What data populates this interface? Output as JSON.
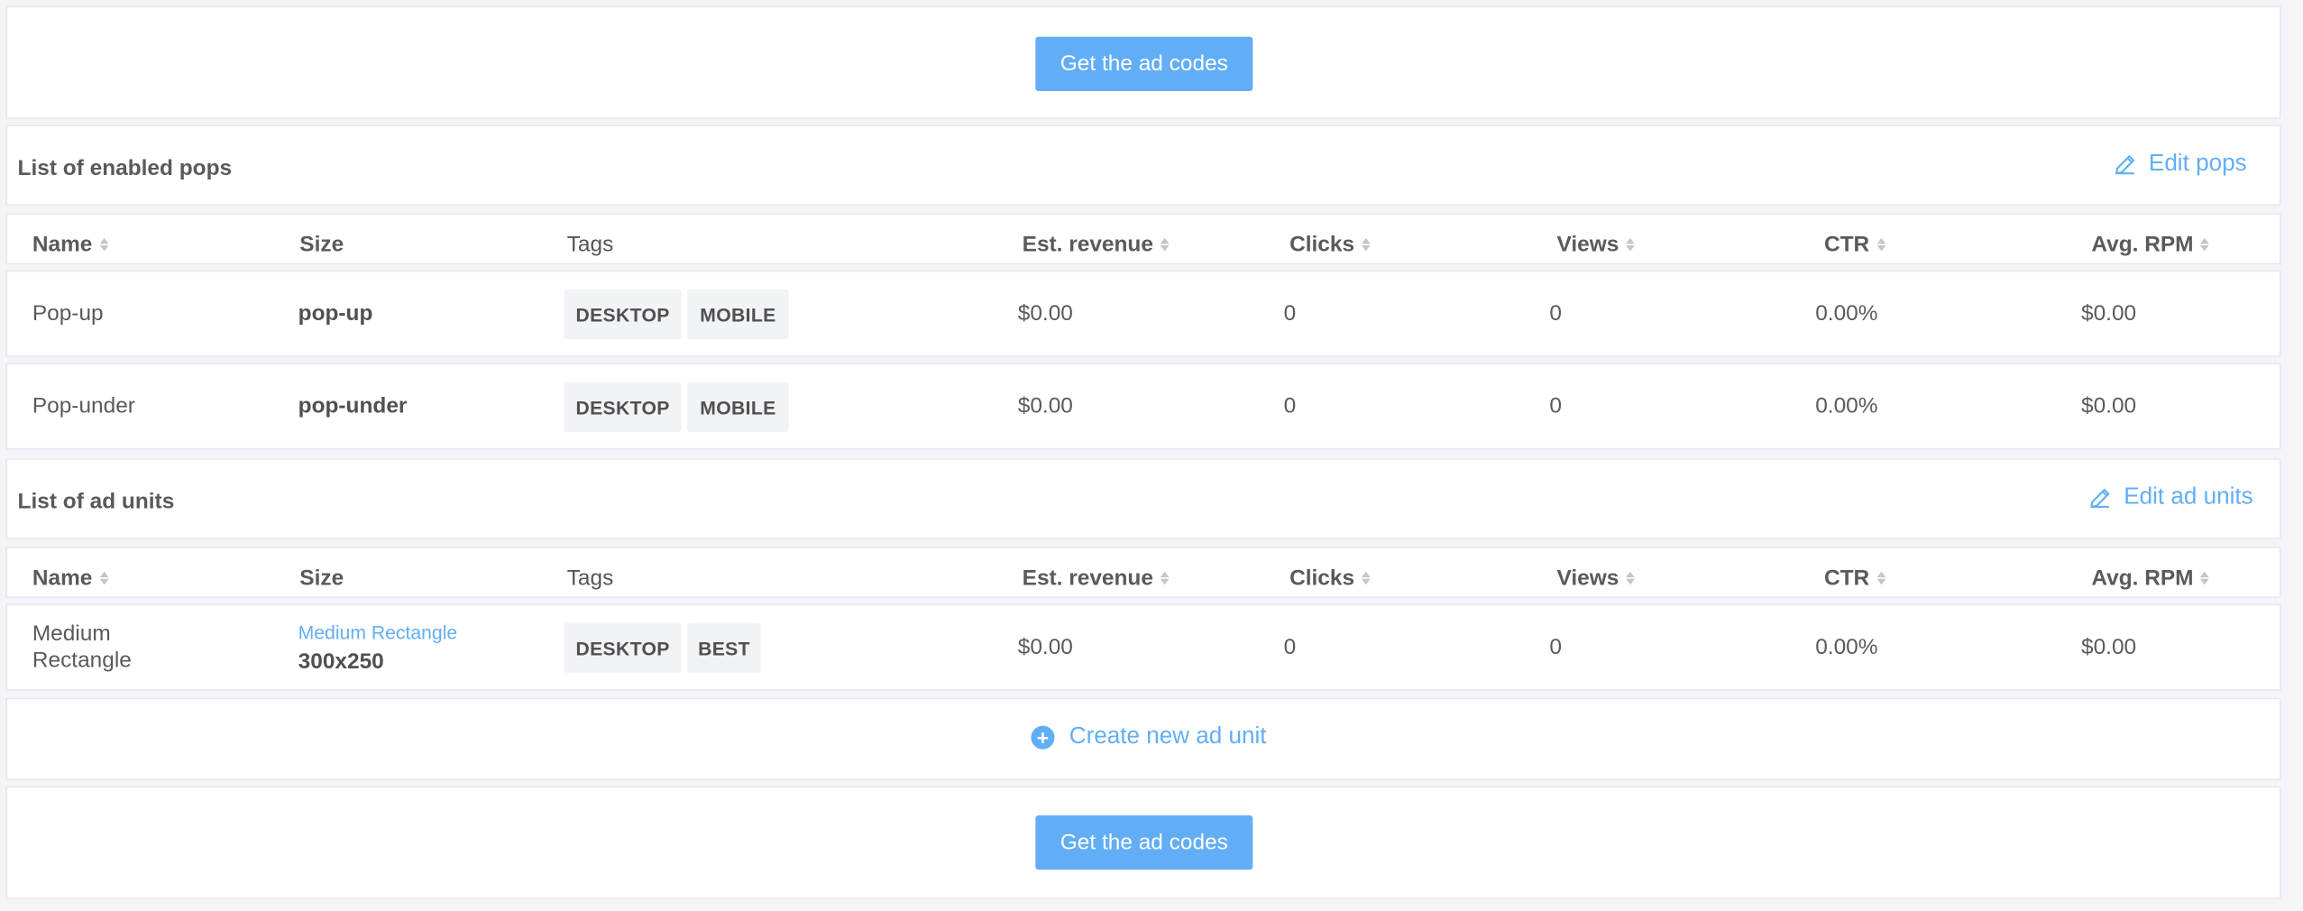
{
  "get_codes_label": "Get the ad codes",
  "pops": {
    "title": "List of enabled pops",
    "edit_label": "Edit pops",
    "columns": {
      "name": "Name",
      "size": "Size",
      "tags": "Tags",
      "revenue": "Est. revenue",
      "clicks": "Clicks",
      "views": "Views",
      "ctr": "CTR",
      "rpm": "Avg. RPM"
    },
    "rows": [
      {
        "name": "Pop-up",
        "size": "pop-up",
        "tags": [
          "DESKTOP",
          "MOBILE"
        ],
        "revenue": "$0.00",
        "clicks": "0",
        "views": "0",
        "ctr": "0.00%",
        "rpm": "$0.00"
      },
      {
        "name": "Pop-under",
        "size": "pop-under",
        "tags": [
          "DESKTOP",
          "MOBILE"
        ],
        "revenue": "$0.00",
        "clicks": "0",
        "views": "0",
        "ctr": "0.00%",
        "rpm": "$0.00"
      }
    ]
  },
  "units": {
    "title": "List of ad units",
    "edit_label": "Edit ad units",
    "columns": {
      "name": "Name",
      "size": "Size",
      "tags": "Tags",
      "revenue": "Est. revenue",
      "clicks": "Clicks",
      "views": "Views",
      "ctr": "CTR",
      "rpm": "Avg. RPM"
    },
    "rows": [
      {
        "name_line1": "Medium",
        "name_line2": "Rectangle",
        "size_link": "Medium Rectangle",
        "size": "300x250",
        "tags": [
          "DESKTOP",
          "BEST"
        ],
        "revenue": "$0.00",
        "clicks": "0",
        "views": "0",
        "ctr": "0.00%",
        "rpm": "$0.00"
      }
    ],
    "create_label": "Create new ad unit"
  },
  "colors": {
    "accent": "#62aef6",
    "background": "#f4f5f8",
    "tag_bg": "#f2f3f7"
  },
  "icons": {
    "edit": "pencil-icon",
    "create": "plus-circle-icon",
    "sort": "sort-icon"
  }
}
